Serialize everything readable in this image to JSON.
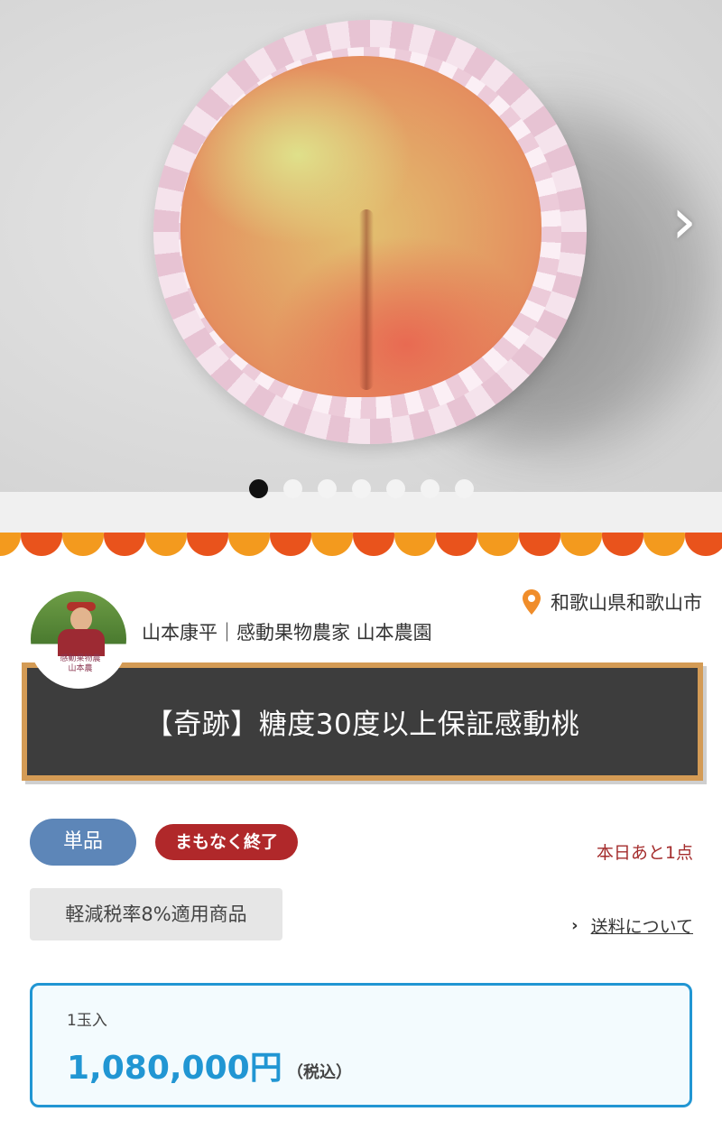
{
  "hero": {
    "next_arrow": "›",
    "slide_count": 7,
    "active_slide": 1
  },
  "producer": {
    "location": "和歌山県和歌山市",
    "name": "山本康平｜感動果物農家 山本農園",
    "avatar_badge_line1": "感動果物農",
    "avatar_badge_line2": "山本農"
  },
  "product": {
    "title": "【奇跡】糖度30度以上保証感動桃"
  },
  "tags": {
    "single": "単品",
    "ending_soon": "まもなく終了"
  },
  "stock_text": "本日あと1点",
  "tax_badge": "軽減税率8%適用商品",
  "shipping_link": "送料について",
  "price_card": {
    "variant": "1玉入",
    "price": "1,080,000円",
    "tax_note": "（税込）"
  },
  "colors": {
    "accent_blue": "#2196d3",
    "tag_blue": "#5d86b8",
    "tag_red": "#b0282a",
    "stock_red": "#a42c2c",
    "board_bg": "#3d3d3d",
    "board_frame": "#d49b55",
    "scallop_orange": "#f39a1e",
    "scallop_red": "#e9531c",
    "pin_orange": "#f08d2a"
  }
}
